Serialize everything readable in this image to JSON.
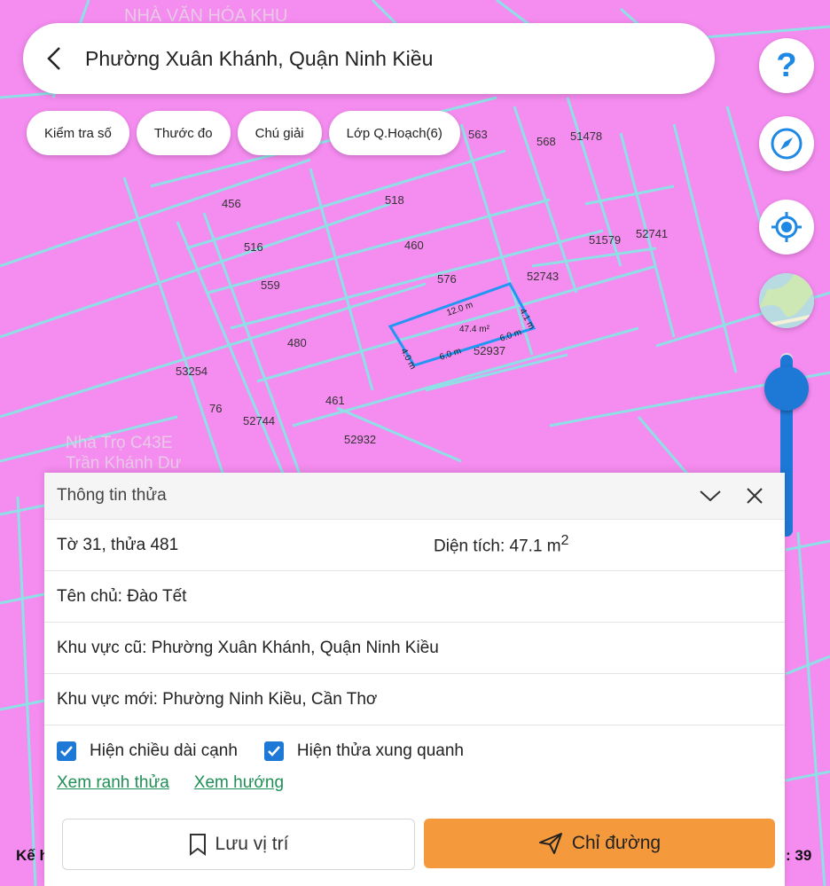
{
  "header": {
    "title": "Phường Xuân Khánh, Quận Ninh Kiều"
  },
  "chips": [
    "Kiểm tra số",
    "Thước đo",
    "Chú giải",
    "Lớp Q.Hoạch(6)"
  ],
  "fabs": {
    "help": "?"
  },
  "map": {
    "labels": {
      "p563": "563",
      "p568": "568",
      "p51478": "51478",
      "p456": "456",
      "p518": "518",
      "p516": "516",
      "p460": "460",
      "p51579": "51579",
      "p52741": "52741",
      "p559": "559",
      "p576": "576",
      "p52743": "52743",
      "p480": "480",
      "p52937": "52937",
      "p53254": "53254",
      "p76": "76",
      "p461": "461",
      "p52744": "52744",
      "p52932": "52932"
    },
    "poi": {
      "top": "NHÀ VĂN HÓA KHU",
      "nhatro": "Nhà Trọ C43E",
      "tran": "Trần Khánh Dư"
    },
    "parcel": {
      "area": "47.4 m²",
      "top": "12.0 m",
      "right": "4.1 m",
      "bottom_right": "6.0 m",
      "bottom_left": "6.0 m",
      "left": "4.0 m"
    },
    "scale": {
      "left": "Kế h",
      "right": ": 39"
    }
  },
  "sheet": {
    "title": "Thông tin thửa",
    "sheet_parcel": "Tờ 31, thửa 481",
    "area_label": "Diện tích: 47.1 m",
    "area_sup": "2",
    "owner": "Tên chủ: Đào Tết",
    "old_area": "Khu vực cũ: Phường Xuân Khánh, Quận Ninh Kiều",
    "new_area": "Khu vực mới: Phường Ninh Kiều, Cần Thơ",
    "check1": "Hiện chiều dài cạnh",
    "check2": "Hiện thửa xung quanh",
    "link1": "Xem ranh thửa",
    "link2": "Xem hướng",
    "save_label": "Lưu vị trí",
    "dir_label": "Chỉ đường"
  },
  "colors": {
    "map_bg": "#f58cf0",
    "boundary": "#8ee0e6",
    "parcel": "#2196f3",
    "accent": "#1e78d6",
    "button": "#f59a3c",
    "link": "#1f8f55"
  },
  "icons": [
    "back-arrow-icon",
    "help-icon",
    "compass-icon",
    "locate-icon",
    "layer-icon",
    "chevron-down-icon",
    "close-icon",
    "bookmark-icon",
    "navigation-icon",
    "check-icon"
  ]
}
